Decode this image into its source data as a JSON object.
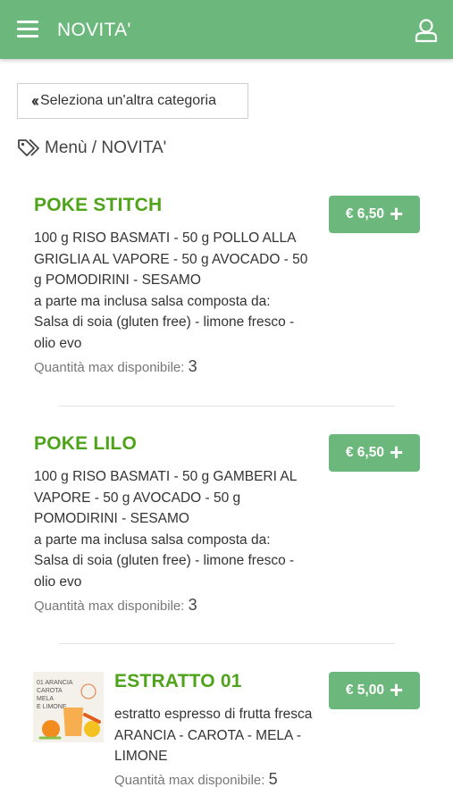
{
  "header": {
    "title": "NOVITA'",
    "menu_icon": "hamburger-menu-icon",
    "user_icon": "user-icon"
  },
  "nav": {
    "back_label": "Seleziona un'altra categoria",
    "breadcrumb": "Menù / NOVITA'"
  },
  "qty_label": "Quantità max disponibile:",
  "products": [
    {
      "name": "POKE STITCH",
      "desc": [
        "100 g RISO BASMATI - 50 g POLLO ALLA",
        "GRIGLIA AL VAPORE - 50 g AVOCADO - 50",
        "g POMODIRINI - SESAMO",
        "a parte ma inclusa salsa composta da:",
        "Salsa di soia (gluten free) - limone fresco -",
        "olio evo"
      ],
      "qty": "3",
      "price": "€ 6,50"
    },
    {
      "name": "POKE LILO",
      "desc": [
        "100 g RISO BASMATI - 50 g GAMBERI AL",
        "VAPORE - 50 g AVOCADO - 50 g",
        "POMODIRINI - SESAMO",
        "a parte ma inclusa salsa composta da:",
        "Salsa di soia (gluten free) - limone fresco -",
        "olio evo"
      ],
      "qty": "3",
      "price": "€ 6,50"
    },
    {
      "name": "ESTRATTO 01",
      "desc": [
        "estratto espresso di frutta fresca",
        "ARANCIA - CAROTA - MELA -",
        "LIMONE"
      ],
      "qty": "5",
      "price": "€ 5,00",
      "image_text": [
        "01 ARANCIA",
        "CAROTA",
        "MELA",
        "E LIMONE"
      ]
    }
  ],
  "colors": {
    "header_bg": "#6cb87c",
    "accent_green": "#4fa31a",
    "button_green": "#6cb87c"
  }
}
